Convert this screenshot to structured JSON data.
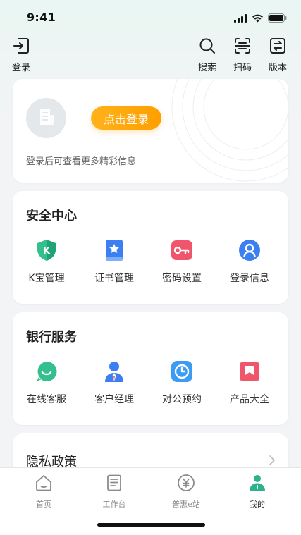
{
  "status_bar": {
    "time": "9:41"
  },
  "top_nav": {
    "login_label": "登录",
    "search_label": "搜索",
    "scan_label": "扫码",
    "version_label": "版本"
  },
  "login_card": {
    "button_label": "点击登录",
    "hint": "登录后可查看更多精彩信息"
  },
  "security_center": {
    "title": "安全中心",
    "items": [
      {
        "label": "K宝管理",
        "icon": "k-shield-icon"
      },
      {
        "label": "证书管理",
        "icon": "certificate-icon"
      },
      {
        "label": "密码设置",
        "icon": "key-icon"
      },
      {
        "label": "登录信息",
        "icon": "user-info-icon"
      }
    ]
  },
  "bank_services": {
    "title": "银行服务",
    "items": [
      {
        "label": "在线客服",
        "icon": "chat-icon"
      },
      {
        "label": "客户经理",
        "icon": "manager-icon"
      },
      {
        "label": "对公预约",
        "icon": "clock-icon"
      },
      {
        "label": "产品大全",
        "icon": "bookmark-icon"
      }
    ]
  },
  "privacy": {
    "title": "隐私政策"
  },
  "tab_bar": {
    "tabs": [
      {
        "label": "首页",
        "icon": "home-icon"
      },
      {
        "label": "工作台",
        "icon": "document-icon"
      },
      {
        "label": "普惠e站",
        "icon": "yuan-icon"
      },
      {
        "label": "我的",
        "icon": "person-icon"
      }
    ],
    "active_index": 3
  },
  "colors": {
    "accent_green": "#2db38b",
    "login_orange": "#ffa600",
    "key_red": "#f0566b",
    "blue": "#3b7ff2"
  }
}
